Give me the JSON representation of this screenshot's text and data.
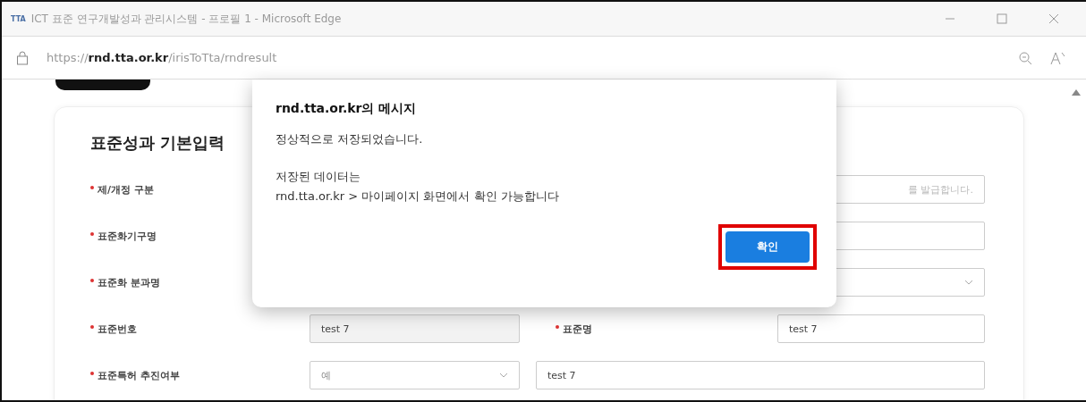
{
  "window": {
    "title": "ICT 표준 연구개발성과 관리시스템 - 프로필 1 - Microsoft Edge",
    "app_badge": "TTA"
  },
  "address_bar": {
    "scheme": "https://",
    "host": "rnd.tta.or.kr",
    "path": "/irisToTta/rndresult"
  },
  "form": {
    "heading": "표준성과 기본입력",
    "rows": [
      {
        "label": "제/개정 구분",
        "right": {
          "kind": "text",
          "placeholder": "를 발급합니다."
        }
      },
      {
        "label": "표준화기구명",
        "right": {
          "kind": "text"
        }
      },
      {
        "label": "표준화 분과명",
        "right": {
          "kind": "select"
        }
      },
      {
        "label": "표준번호",
        "left": {
          "kind": "text",
          "value": "test 7"
        },
        "label2": "표준명",
        "right": {
          "kind": "text",
          "value": "test 7"
        }
      },
      {
        "label": "표준특허 추진여부",
        "left": {
          "kind": "select",
          "value": "예"
        },
        "wide": {
          "kind": "text",
          "value": "test 7"
        }
      }
    ]
  },
  "dialog": {
    "title": "rnd.tta.or.kr의 메시지",
    "lines": [
      "정상적으로 저장되었습니다.",
      "저장된 데이터는",
      "rnd.tta.or.kr > 마이페이지 화면에서 확인 가능합니다"
    ],
    "button": "확인",
    "button_highlighted": true
  }
}
